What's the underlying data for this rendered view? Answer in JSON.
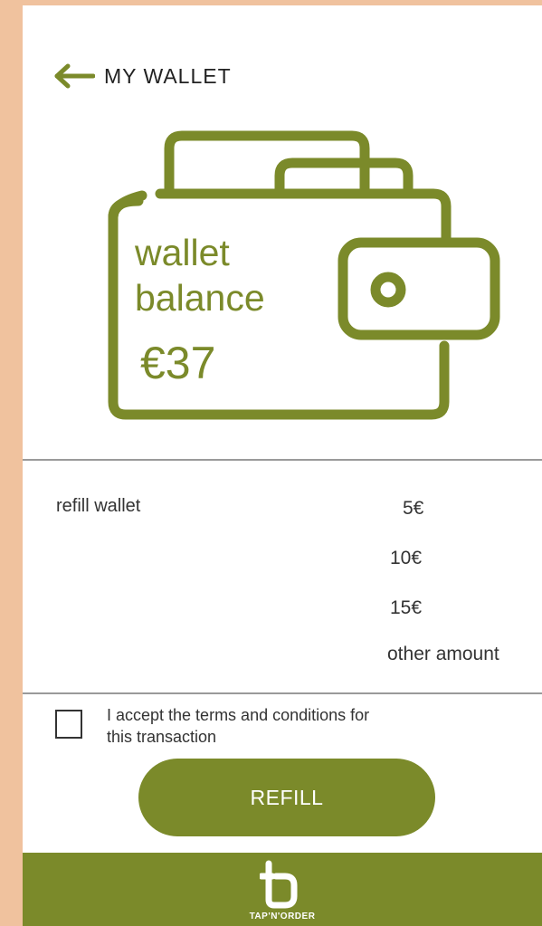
{
  "header": {
    "title": "MY WALLET",
    "back_icon": "arrow-left-icon"
  },
  "wallet": {
    "label": "wallet balance",
    "amount": "€37",
    "icon": "wallet-icon"
  },
  "refill": {
    "label": "refill wallet",
    "options": [
      "5€",
      "10€",
      "15€",
      "other amount"
    ]
  },
  "terms": {
    "text": "I accept the terms and conditions for this transaction",
    "checked": false
  },
  "refill_button": {
    "label": "REFILL"
  },
  "footer": {
    "brand": "TAP'N'ORDER",
    "logo_icon": "tapnorder-logo-icon"
  },
  "colors": {
    "accent": "#7b8a2a",
    "outer_bg": "#f0c29e",
    "divider": "#9a9a9a"
  }
}
